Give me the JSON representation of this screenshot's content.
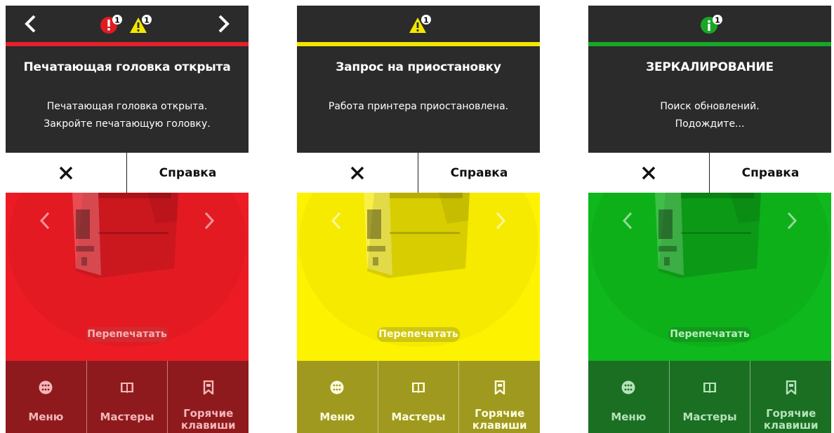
{
  "panels": [
    {
      "theme": "error",
      "colors": {
        "accent": "#e5202a",
        "hero": "#ed1c24",
        "bottom": "#8e1a1d",
        "reprint_bg": "#d32a2f",
        "reprint_fg": "#f5b2b4"
      },
      "status_icons": [
        "error-icon",
        "warning-icon"
      ],
      "badge_counts": [
        "1",
        "1"
      ],
      "show_nav": true,
      "title": "Печатающая головка открыта",
      "body": [
        "Печатающая головка открыта.",
        "Закройте печатающую головку."
      ],
      "close_label": "✕",
      "help_label": "Справка",
      "reprint_label": "Перепечатать",
      "menu_label": "Меню",
      "wizards_label": "Мастеры",
      "shortcuts_label": [
        "Горячие",
        "клавиши"
      ]
    },
    {
      "theme": "warning",
      "colors": {
        "accent": "#f2e600",
        "hero": "#fdf200",
        "bottom": "#9f9a1f",
        "reprint_bg": "#cfc712",
        "reprint_fg": "#fffde0"
      },
      "status_icons": [
        "warning-icon"
      ],
      "badge_counts": [
        "1"
      ],
      "show_nav": false,
      "title": "Запрос на приостановку",
      "body": [
        "Работа принтера приостановлена."
      ],
      "close_label": "✕",
      "help_label": "Справка",
      "reprint_label": "Перепечатать",
      "menu_label": "Меню",
      "wizards_label": "Мастеры",
      "shortcuts_label": [
        "Горячие",
        "клавиши"
      ]
    },
    {
      "theme": "info",
      "colors": {
        "accent": "#16a726",
        "hero": "#0fb81c",
        "bottom": "#1a6f22",
        "reprint_bg": "#119a1c",
        "reprint_fg": "#b8f0bd"
      },
      "status_icons": [
        "info-icon"
      ],
      "badge_counts": [
        "1"
      ],
      "show_nav": false,
      "title": "ЗЕРКАЛИРОВАНИЕ",
      "body": [
        "Поиск обновлений.",
        "Подождите..."
      ],
      "close_label": "✕",
      "help_label": "Справка",
      "reprint_label": "Перепечатать",
      "menu_label": "Меню",
      "wizards_label": "Мастеры",
      "shortcuts_label": [
        "Горячие",
        "клавиши"
      ]
    }
  ]
}
